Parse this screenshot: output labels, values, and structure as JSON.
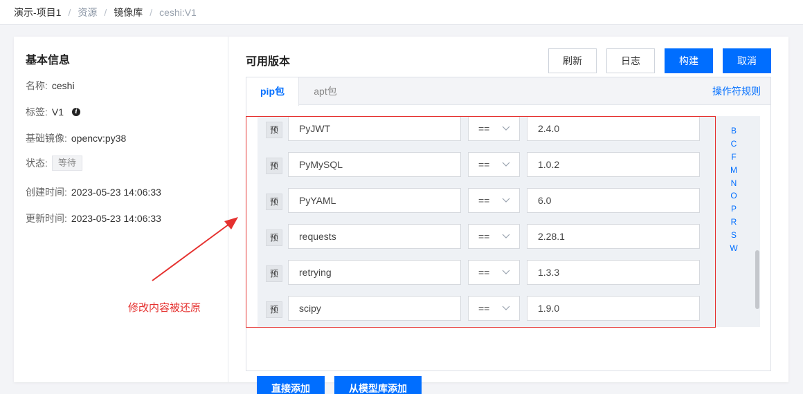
{
  "breadcrumb": {
    "project": "演示-项目1",
    "resources": "资源",
    "image_repo": "镜像库",
    "current": "ceshi:V1",
    "separator": "/"
  },
  "basic_info": {
    "title": "基本信息",
    "name_label": "名称:",
    "name_value": "ceshi",
    "tag_label": "标签:",
    "tag_value": "V1",
    "base_image_label": "基础镜像:",
    "base_image_value": "opencv:py38",
    "status_label": "状态:",
    "status_value": "等待",
    "created_label": "创建时间:",
    "created_value": "2023-05-23 14:06:33",
    "updated_label": "更新时间:",
    "updated_value": "2023-05-23 14:06:33"
  },
  "versions": {
    "title": "可用版本",
    "buttons": {
      "refresh": "刷新",
      "log": "日志",
      "build": "构建",
      "cancel": "取消"
    },
    "tabs": {
      "pip": "pip包",
      "apt": "apt包"
    },
    "operator_rules": "操作符规则",
    "packages": [
      {
        "tag": "预",
        "name": "PyJWT",
        "operator": "==",
        "version": "2.4.0"
      },
      {
        "tag": "预",
        "name": "PyMySQL",
        "operator": "==",
        "version": "1.0.2"
      },
      {
        "tag": "预",
        "name": "PyYAML",
        "operator": "==",
        "version": "6.0"
      },
      {
        "tag": "预",
        "name": "requests",
        "operator": "==",
        "version": "2.28.1"
      },
      {
        "tag": "预",
        "name": "retrying",
        "operator": "==",
        "version": "1.3.3"
      },
      {
        "tag": "预",
        "name": "scipy",
        "operator": "==",
        "version": "1.9.0"
      }
    ],
    "index_letters": [
      "B",
      "C",
      "F",
      "M",
      "N",
      "O",
      "P",
      "R",
      "S",
      "W"
    ],
    "add_direct": "直接添加",
    "add_from_model_repo": "从模型库添加"
  },
  "annotation": {
    "text": "修改内容被还原",
    "color": "#e5312f"
  },
  "colors": {
    "primary": "#006eff",
    "annotation_red": "#e5312f"
  }
}
